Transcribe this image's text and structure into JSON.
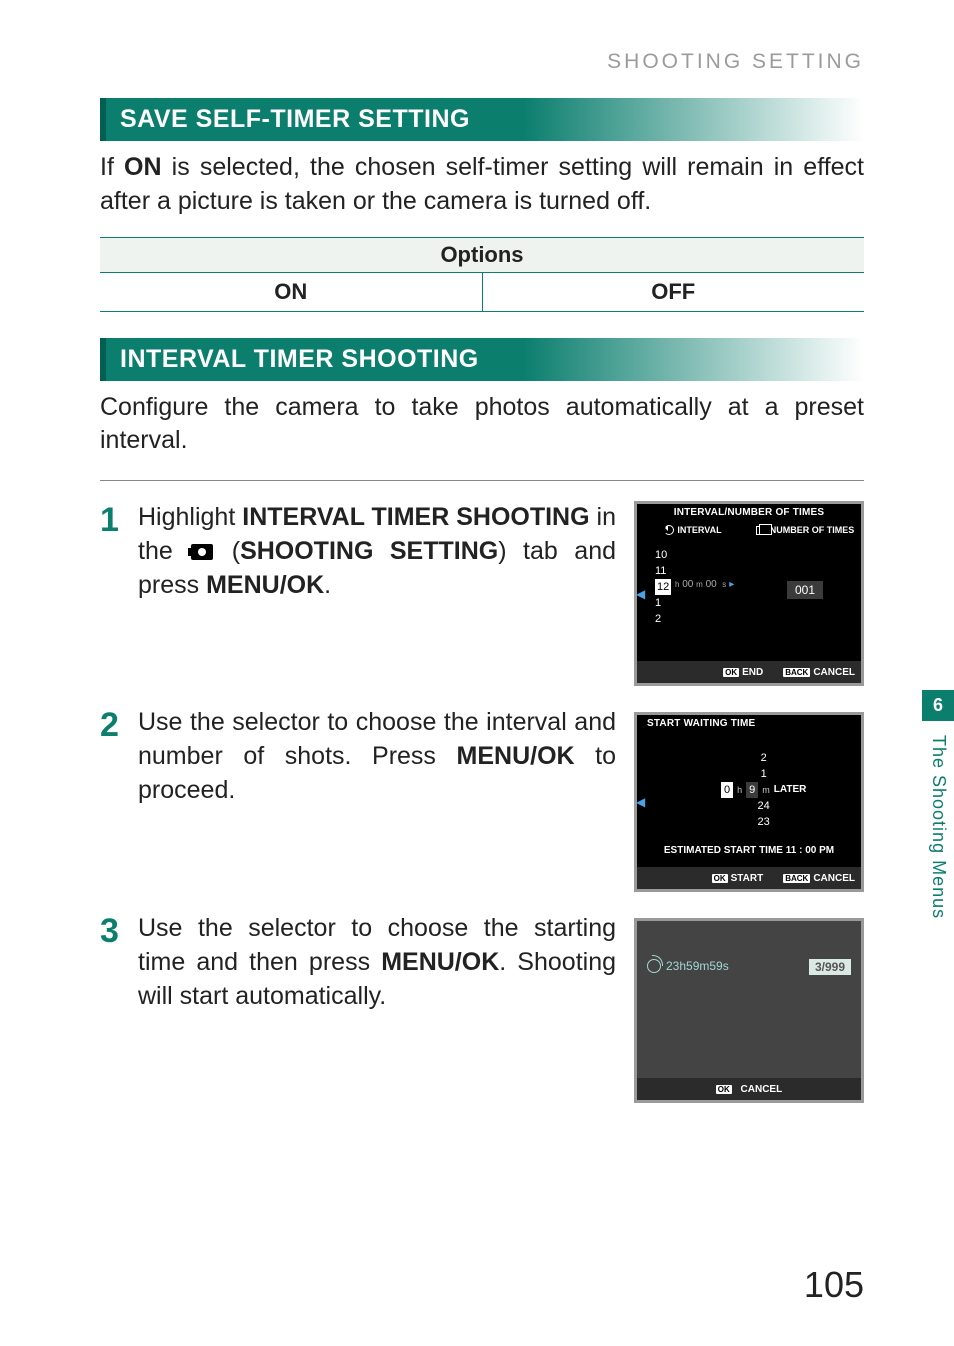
{
  "breadcrumb": "SHOOTING SETTING",
  "section1": {
    "title": "SAVE SELF-TIMER SETTING",
    "para_lead": "If ",
    "para_bold1": "ON",
    "para_rest": " is selected, the chosen self-timer setting will remain in effect after a picture is taken or the camera is turned off."
  },
  "options_table": {
    "header": "Options",
    "left": "ON",
    "right": "OFF"
  },
  "section2": {
    "title": "INTERVAL TIMER SHOOTING",
    "para": "Configure the camera to take photos automatically at a preset interval."
  },
  "steps": {
    "s1": {
      "num": "1",
      "t1": "Highlight ",
      "b1": "INTERVAL TIMER SHOOTING",
      "t2": " in the ",
      "t3": " (",
      "b2": "SHOOTING SETTING",
      "t4": ") tab and press ",
      "b3": "MENU/OK",
      "t5": "."
    },
    "s2": {
      "num": "2",
      "t1": "Use the selector to choose the interval and number of shots. Press ",
      "b1": "MENU/OK",
      "t2": " to proceed."
    },
    "s3": {
      "num": "3",
      "t1": "Use the selector to choose the starting time and then press ",
      "b1": "MENU/OK",
      "t2": ". Shooting will start automatically."
    }
  },
  "screen1": {
    "title": "INTERVAL/NUMBER OF TIMES",
    "col1_head": "INTERVAL",
    "col2_head": "NUMBER OF TIMES",
    "nums": {
      "a": "10",
      "b": "11",
      "sel": "12",
      "d": "1",
      "e": "2"
    },
    "time_h": "00",
    "time_m": "00",
    "time_s_label": "s",
    "times_value": "001",
    "ok_label": "END",
    "back_label": "CANCEL"
  },
  "screen2": {
    "title": "START WAITING TIME",
    "nums": {
      "a": "2",
      "b": "1",
      "sel": "0",
      "d": "24",
      "e": "23"
    },
    "unit_h": "h",
    "min_val": "9",
    "unit_m": "m",
    "later": "LATER",
    "estimate": "ESTIMATED START TIME 11 : 00 PM",
    "ok_label": "START",
    "back_label": "CANCEL"
  },
  "screen3": {
    "countdown": "23h59m59s",
    "badge": "3/999",
    "ok_label": "CANCEL"
  },
  "side": {
    "chapter_num": "6",
    "chapter_text": "The Shooting Menus"
  },
  "page_number": "105",
  "badge_ok_text": "OK",
  "badge_back_text": "BACK"
}
